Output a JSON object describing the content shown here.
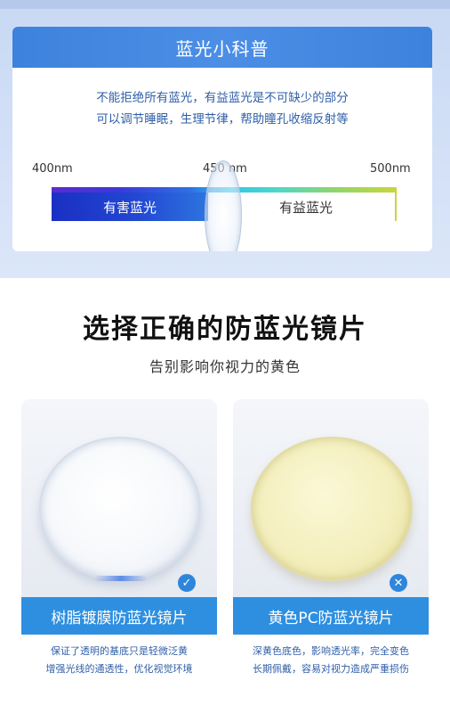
{
  "science": {
    "title": "蓝光小科普",
    "desc_line1": "不能拒绝所有蓝光，有益蓝光是不可缺少的部分",
    "desc_line2": "可以调节睡眠，生理节律，帮助瞳孔收缩反射等",
    "scale": {
      "left": "400nm",
      "mid": "450 nm",
      "right": "500nm"
    },
    "harmful_label": "有害蓝光",
    "beneficial_label": "有益蓝光"
  },
  "section": {
    "title": "选择正确的防蓝光镜片",
    "subtitle": "告别影响你视力的黄色"
  },
  "products": [
    {
      "name": "树脂镀膜防蓝光镜片",
      "desc_line1": "保证了透明的基底只是轻微泛黄",
      "desc_line2": "增强光线的通透性，优化视觉环境",
      "badge": "✓",
      "badge_icon": "check-icon"
    },
    {
      "name": "黄色PC防蓝光镜片",
      "desc_line1": "深黄色底色，影响透光率，完全变色",
      "desc_line2": "长期佩戴，容易对视力造成严重损伤",
      "badge": "✕",
      "badge_icon": "cross-icon"
    }
  ],
  "colors": {
    "accent": "#2e8fe0",
    "header_blue": "#3d82dc",
    "background_band": "#c9d9f4"
  }
}
